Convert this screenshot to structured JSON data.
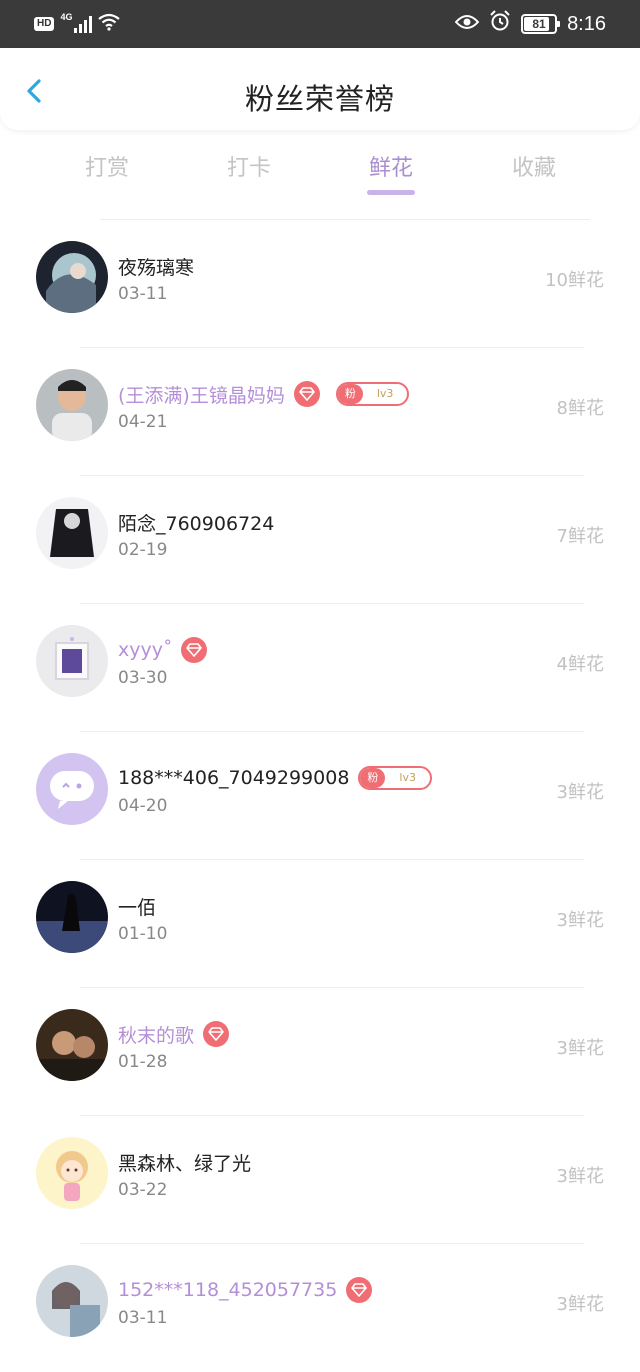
{
  "status_bar": {
    "hd": "HD",
    "network": "4G",
    "battery": "81",
    "time": "8:16"
  },
  "header": {
    "title": "粉丝荣誉榜"
  },
  "tabs": [
    {
      "label": "打赏",
      "active": false
    },
    {
      "label": "打卡",
      "active": false
    },
    {
      "label": "鲜花",
      "active": true
    },
    {
      "label": "收藏",
      "active": false
    }
  ],
  "fans": [
    {
      "name": "夜殇璃寒",
      "date": "03-11",
      "count": "10鲜花",
      "vip": false,
      "level": null
    },
    {
      "name": "(王添满)王镜晶妈妈",
      "date": "04-21",
      "count": "8鲜花",
      "vip": true,
      "level": {
        "tag": "粉",
        "lv": "lv3"
      }
    },
    {
      "name": "陌念_760906724",
      "date": "02-19",
      "count": "7鲜花",
      "vip": false,
      "level": null
    },
    {
      "name": "xyyy˚",
      "date": "03-30",
      "count": "4鲜花",
      "vip": true,
      "level": null
    },
    {
      "name": "188***406_7049299008",
      "date": "04-20",
      "count": "3鲜花",
      "vip": false,
      "level": {
        "tag": "粉",
        "lv": "lv3"
      }
    },
    {
      "name": "一佰",
      "date": "01-10",
      "count": "3鲜花",
      "vip": false,
      "level": null
    },
    {
      "name": "秋末的歌",
      "date": "01-28",
      "count": "3鲜花",
      "vip": true,
      "level": null
    },
    {
      "name": "黑森林、绿了光",
      "date": "03-22",
      "count": "3鲜花",
      "vip": false,
      "level": null
    },
    {
      "name": "152***118_452057735",
      "date": "03-11",
      "count": "3鲜花",
      "vip": true,
      "level": null
    }
  ],
  "colors": {
    "accent": "#a98fd0",
    "vip_name": "#b48fd8",
    "badge_red": "#f06e73",
    "back_arrow": "#2ea7e0"
  }
}
